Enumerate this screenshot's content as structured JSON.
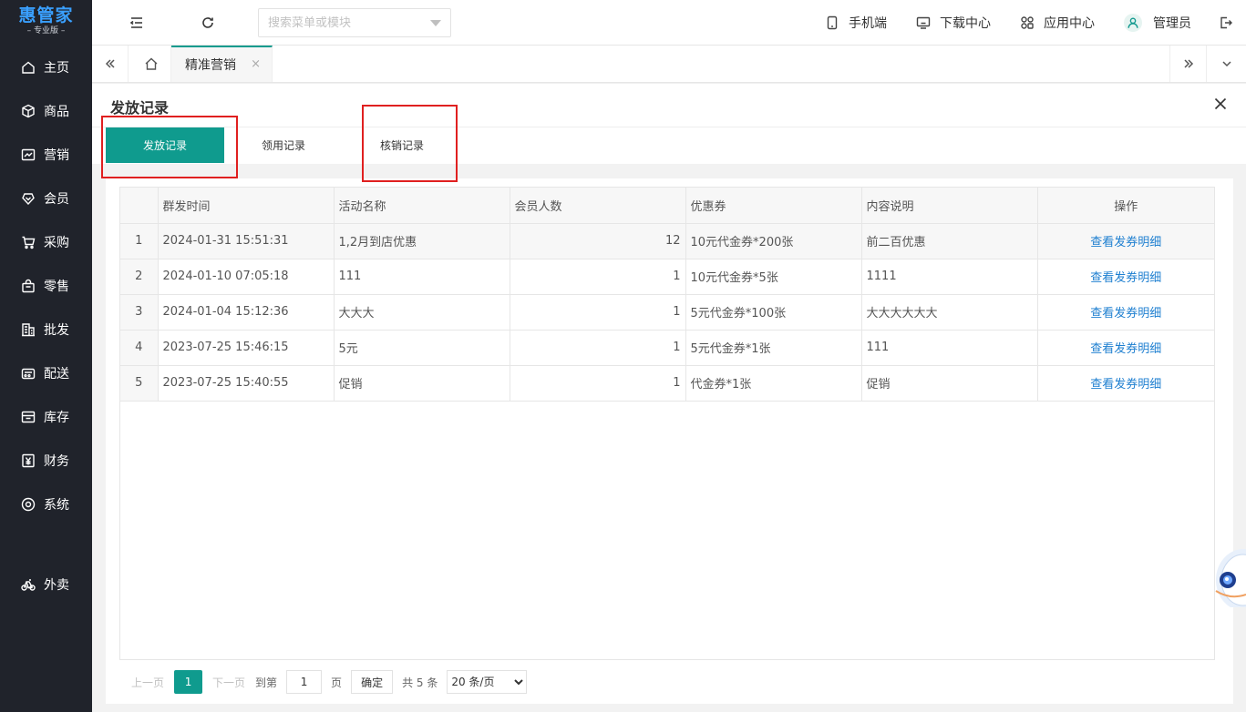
{
  "app": {
    "logo": "惠管家",
    "edition": "– 专业版 –"
  },
  "sidebar": {
    "items": [
      {
        "label": "主页",
        "icon": "home-icon"
      },
      {
        "label": "商品",
        "icon": "box-icon"
      },
      {
        "label": "营销",
        "icon": "chart-icon"
      },
      {
        "label": "会员",
        "icon": "heart-icon"
      },
      {
        "label": "采购",
        "icon": "cart-icon"
      },
      {
        "label": "零售",
        "icon": "bag-icon"
      },
      {
        "label": "批发",
        "icon": "building-icon"
      },
      {
        "label": "配送",
        "icon": "truck-icon"
      },
      {
        "label": "库存",
        "icon": "inbox-icon"
      },
      {
        "label": "财务",
        "icon": "yen-icon"
      },
      {
        "label": "系统",
        "icon": "settings-icon"
      },
      {
        "label": "外卖",
        "icon": "bike-icon"
      }
    ]
  },
  "topbar": {
    "search_placeholder": "搜索菜单或模块",
    "mobile": "手机端",
    "download": "下载中心",
    "apps": "应用中心",
    "user": "管理员"
  },
  "tabs": {
    "active": "精准营销",
    "close": "×"
  },
  "panel": {
    "title": "发放记录",
    "subtabs": [
      "发放记录",
      "领用记录",
      "核销记录"
    ]
  },
  "table": {
    "headers": [
      "",
      "群发时间",
      "活动名称",
      "会员人数",
      "优惠券",
      "内容说明",
      "操作"
    ],
    "rows": [
      {
        "idx": "1",
        "time": "2024-01-31 15:51:31",
        "name": "1,2月到店优惠",
        "count": "12",
        "coupon": "10元代金券*200张",
        "desc": "前二百优惠",
        "action": "查看发券明细"
      },
      {
        "idx": "2",
        "time": "2024-01-10 07:05:18",
        "name": "111",
        "count": "1",
        "coupon": "10元代金券*5张",
        "desc": "1111",
        "action": "查看发券明细"
      },
      {
        "idx": "3",
        "time": "2024-01-04 15:12:36",
        "name": "大大大",
        "count": "1",
        "coupon": "5元代金券*100张",
        "desc": "大大大大大大",
        "action": "查看发券明细"
      },
      {
        "idx": "4",
        "time": "2023-07-25 15:46:15",
        "name": "5元",
        "count": "1",
        "coupon": "5元代金券*1张",
        "desc": "111",
        "action": "查看发券明细"
      },
      {
        "idx": "5",
        "time": "2023-07-25 15:40:55",
        "name": "促销",
        "count": "1",
        "coupon": "代金券*1张",
        "desc": "促销",
        "action": "查看发券明细"
      }
    ]
  },
  "pager": {
    "prev": "上一页",
    "current": "1",
    "next": "下一页",
    "goto": "到第",
    "page_value": "1",
    "page_unit": "页",
    "confirm": "确定",
    "total": "共 5 条",
    "page_size": "20 条/页"
  }
}
